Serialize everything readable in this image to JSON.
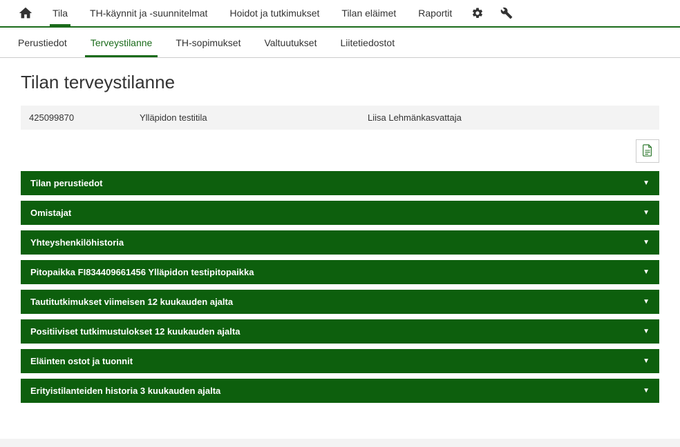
{
  "topnav": {
    "items": [
      {
        "label": "Tila",
        "active": true
      },
      {
        "label": "TH-käynnit ja -suunnitelmat",
        "active": false
      },
      {
        "label": "Hoidot ja tutkimukset",
        "active": false
      },
      {
        "label": "Tilan eläimet",
        "active": false
      },
      {
        "label": "Raportit",
        "active": false
      }
    ]
  },
  "subnav": {
    "items": [
      {
        "label": "Perustiedot",
        "active": false
      },
      {
        "label": "Terveystilanne",
        "active": true
      },
      {
        "label": "TH-sopimukset",
        "active": false
      },
      {
        "label": "Valtuutukset",
        "active": false
      },
      {
        "label": "Liitetiedostot",
        "active": false
      }
    ]
  },
  "page": {
    "title": "Tilan terveystilanne"
  },
  "info": {
    "id": "425099870",
    "name": "Ylläpidon testitila",
    "owner": "Liisa Lehmänkasvattaja"
  },
  "accordions": [
    {
      "label": "Tilan perustiedot"
    },
    {
      "label": "Omistajat"
    },
    {
      "label": "Yhteyshenkilöhistoria"
    },
    {
      "label": "Pitopaikka FI834409661456 Ylläpidon testipitopaikka"
    },
    {
      "label": "Tautitutkimukset viimeisen 12 kuukauden ajalta"
    },
    {
      "label": "Positiiviset tutkimustulokset 12 kuukauden ajalta"
    },
    {
      "label": "Eläinten ostot ja tuonnit"
    },
    {
      "label": "Erityistilanteiden historia 3 kuukauden ajalta"
    }
  ]
}
